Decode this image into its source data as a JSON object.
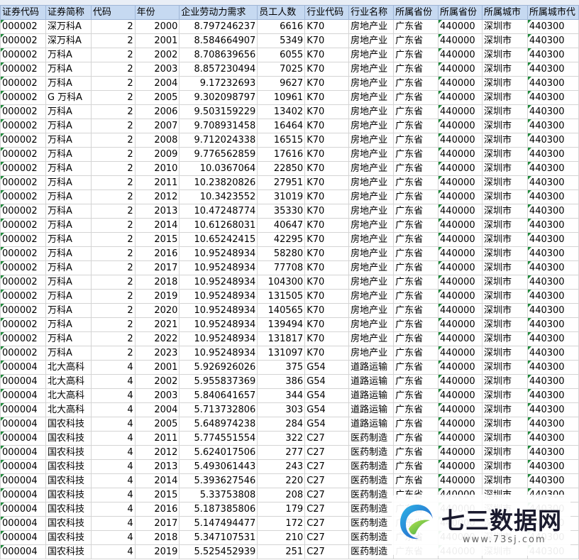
{
  "columns": [
    "证券代码",
    "证券简称",
    "代码",
    "年份",
    "企业劳动力需求",
    "员工人数",
    "行业代码",
    "行业名称",
    "所属省份",
    "所属省份",
    "所属城市",
    "所属城市代"
  ],
  "rows": [
    [
      "000002",
      "深万科A",
      "2",
      "2000",
      "8.797246237",
      "6616",
      "K70",
      "房地产业",
      "广东省",
      "440000",
      "深圳市",
      "440300"
    ],
    [
      "000002",
      "深万科A",
      "2",
      "2001",
      "8.584664907",
      "5349",
      "K70",
      "房地产业",
      "广东省",
      "440000",
      "深圳市",
      "440300"
    ],
    [
      "000002",
      "万科A",
      "2",
      "2002",
      "8.708639656",
      "6055",
      "K70",
      "房地产业",
      "广东省",
      "440000",
      "深圳市",
      "440300"
    ],
    [
      "000002",
      "万科A",
      "2",
      "2003",
      "8.857230494",
      "7025",
      "K70",
      "房地产业",
      "广东省",
      "440000",
      "深圳市",
      "440300"
    ],
    [
      "000002",
      "万科A",
      "2",
      "2004",
      "9.17232693",
      "9627",
      "K70",
      "房地产业",
      "广东省",
      "440000",
      "深圳市",
      "440300"
    ],
    [
      "000002",
      "G 万科A",
      "2",
      "2005",
      "9.302098797",
      "10961",
      "K70",
      "房地产业",
      "广东省",
      "440000",
      "深圳市",
      "440300"
    ],
    [
      "000002",
      "万科A",
      "2",
      "2006",
      "9.503159229",
      "13402",
      "K70",
      "房地产业",
      "广东省",
      "440000",
      "深圳市",
      "440300"
    ],
    [
      "000002",
      "万科A",
      "2",
      "2007",
      "9.708931458",
      "16464",
      "K70",
      "房地产业",
      "广东省",
      "440000",
      "深圳市",
      "440300"
    ],
    [
      "000002",
      "万科A",
      "2",
      "2008",
      "9.712024338",
      "16515",
      "K70",
      "房地产业",
      "广东省",
      "440000",
      "深圳市",
      "440300"
    ],
    [
      "000002",
      "万科A",
      "2",
      "2009",
      "9.776562859",
      "17616",
      "K70",
      "房地产业",
      "广东省",
      "440000",
      "深圳市",
      "440300"
    ],
    [
      "000002",
      "万科A",
      "2",
      "2010",
      "10.0367064",
      "22850",
      "K70",
      "房地产业",
      "广东省",
      "440000",
      "深圳市",
      "440300"
    ],
    [
      "000002",
      "万科A",
      "2",
      "2011",
      "10.23820826",
      "27951",
      "K70",
      "房地产业",
      "广东省",
      "440000",
      "深圳市",
      "440300"
    ],
    [
      "000002",
      "万科A",
      "2",
      "2012",
      "10.3423552",
      "31019",
      "K70",
      "房地产业",
      "广东省",
      "440000",
      "深圳市",
      "440300"
    ],
    [
      "000002",
      "万科A",
      "2",
      "2013",
      "10.47248774",
      "35330",
      "K70",
      "房地产业",
      "广东省",
      "440000",
      "深圳市",
      "440300"
    ],
    [
      "000002",
      "万科A",
      "2",
      "2014",
      "10.61268031",
      "40647",
      "K70",
      "房地产业",
      "广东省",
      "440000",
      "深圳市",
      "440300"
    ],
    [
      "000002",
      "万科A",
      "2",
      "2015",
      "10.65242415",
      "42295",
      "K70",
      "房地产业",
      "广东省",
      "440000",
      "深圳市",
      "440300"
    ],
    [
      "000002",
      "万科A",
      "2",
      "2016",
      "10.95248934",
      "58280",
      "K70",
      "房地产业",
      "广东省",
      "440000",
      "深圳市",
      "440300"
    ],
    [
      "000002",
      "万科A",
      "2",
      "2017",
      "10.95248934",
      "77708",
      "K70",
      "房地产业",
      "广东省",
      "440000",
      "深圳市",
      "440300"
    ],
    [
      "000002",
      "万科A",
      "2",
      "2018",
      "10.95248934",
      "104300",
      "K70",
      "房地产业",
      "广东省",
      "440000",
      "深圳市",
      "440300"
    ],
    [
      "000002",
      "万科A",
      "2",
      "2019",
      "10.95248934",
      "131505",
      "K70",
      "房地产业",
      "广东省",
      "440000",
      "深圳市",
      "440300"
    ],
    [
      "000002",
      "万科A",
      "2",
      "2020",
      "10.95248934",
      "140565",
      "K70",
      "房地产业",
      "广东省",
      "440000",
      "深圳市",
      "440300"
    ],
    [
      "000002",
      "万科A",
      "2",
      "2021",
      "10.95248934",
      "139494",
      "K70",
      "房地产业",
      "广东省",
      "440000",
      "深圳市",
      "440300"
    ],
    [
      "000002",
      "万科A",
      "2",
      "2022",
      "10.95248934",
      "131817",
      "K70",
      "房地产业",
      "广东省",
      "440000",
      "深圳市",
      "440300"
    ],
    [
      "000002",
      "万科A",
      "2",
      "2023",
      "10.95248934",
      "131097",
      "K70",
      "房地产业",
      "广东省",
      "440000",
      "深圳市",
      "440300"
    ],
    [
      "000004",
      "北大高科",
      "4",
      "2001",
      "5.926926026",
      "375",
      "G54",
      "道路运输",
      "广东省",
      "440000",
      "深圳市",
      "440300"
    ],
    [
      "000004",
      "北大高科",
      "4",
      "2002",
      "5.955837369",
      "386",
      "G54",
      "道路运输",
      "广东省",
      "440000",
      "深圳市",
      "440300"
    ],
    [
      "000004",
      "北大高科",
      "4",
      "2003",
      "5.840641657",
      "344",
      "G54",
      "道路运输",
      "广东省",
      "440000",
      "深圳市",
      "440300"
    ],
    [
      "000004",
      "北大高科",
      "4",
      "2004",
      "5.713732806",
      "303",
      "G54",
      "道路运输",
      "广东省",
      "440000",
      "深圳市",
      "440300"
    ],
    [
      "000004",
      "国农科技",
      "4",
      "2005",
      "5.648974238",
      "284",
      "G54",
      "道路运输",
      "广东省",
      "440000",
      "深圳市",
      "440300"
    ],
    [
      "000004",
      "国农科技",
      "4",
      "2011",
      "5.774551554",
      "322",
      "C27",
      "医药制造",
      "广东省",
      "440000",
      "深圳市",
      "440300"
    ],
    [
      "000004",
      "国农科技",
      "4",
      "2012",
      "5.624017506",
      "277",
      "C27",
      "医药制造",
      "广东省",
      "440000",
      "深圳市",
      "440300"
    ],
    [
      "000004",
      "国农科技",
      "4",
      "2013",
      "5.493061443",
      "243",
      "C27",
      "医药制造",
      "广东省",
      "440000",
      "深圳市",
      "440300"
    ],
    [
      "000004",
      "国农科技",
      "4",
      "2014",
      "5.393627546",
      "220",
      "C27",
      "医药制造",
      "广东省",
      "440000",
      "深圳市",
      "440300"
    ],
    [
      "000004",
      "国农科技",
      "4",
      "2015",
      "5.33753808",
      "208",
      "C27",
      "医药制造",
      "广东省",
      "440000",
      "深圳市",
      "440300"
    ],
    [
      "000004",
      "国农科技",
      "4",
      "2016",
      "5.187385806",
      "179",
      "C27",
      "医药制造",
      "广东省",
      "440000",
      "深圳市",
      "440300"
    ],
    [
      "000004",
      "国农科技",
      "4",
      "2017",
      "5.147494477",
      "172",
      "C27",
      "医药制造",
      "广东省",
      "440000",
      "深圳市",
      "440300"
    ],
    [
      "000004",
      "国农科技",
      "4",
      "2018",
      "5.347107531",
      "210",
      "C27",
      "医药制造",
      "广东省",
      "440000",
      "深圳市",
      "440300"
    ],
    [
      "000004",
      "国农科技",
      "4",
      "2019",
      "5.525452939",
      "251",
      "C27",
      "医药制造",
      "广东省",
      "440000",
      "深圳市",
      "440300"
    ]
  ],
  "column_align": [
    "txt",
    "txt",
    "num",
    "num",
    "num",
    "num",
    "txt",
    "txt",
    "txt",
    "txt",
    "txt",
    "txt"
  ],
  "flag_columns": [
    0,
    9,
    11
  ],
  "watermark": {
    "title": "七三数据网",
    "url": "www.73sj.com"
  },
  "colors": {
    "header_bg": "#c6d9f1",
    "grid": "#d4d4d4",
    "flag": "#1e8a3a"
  }
}
